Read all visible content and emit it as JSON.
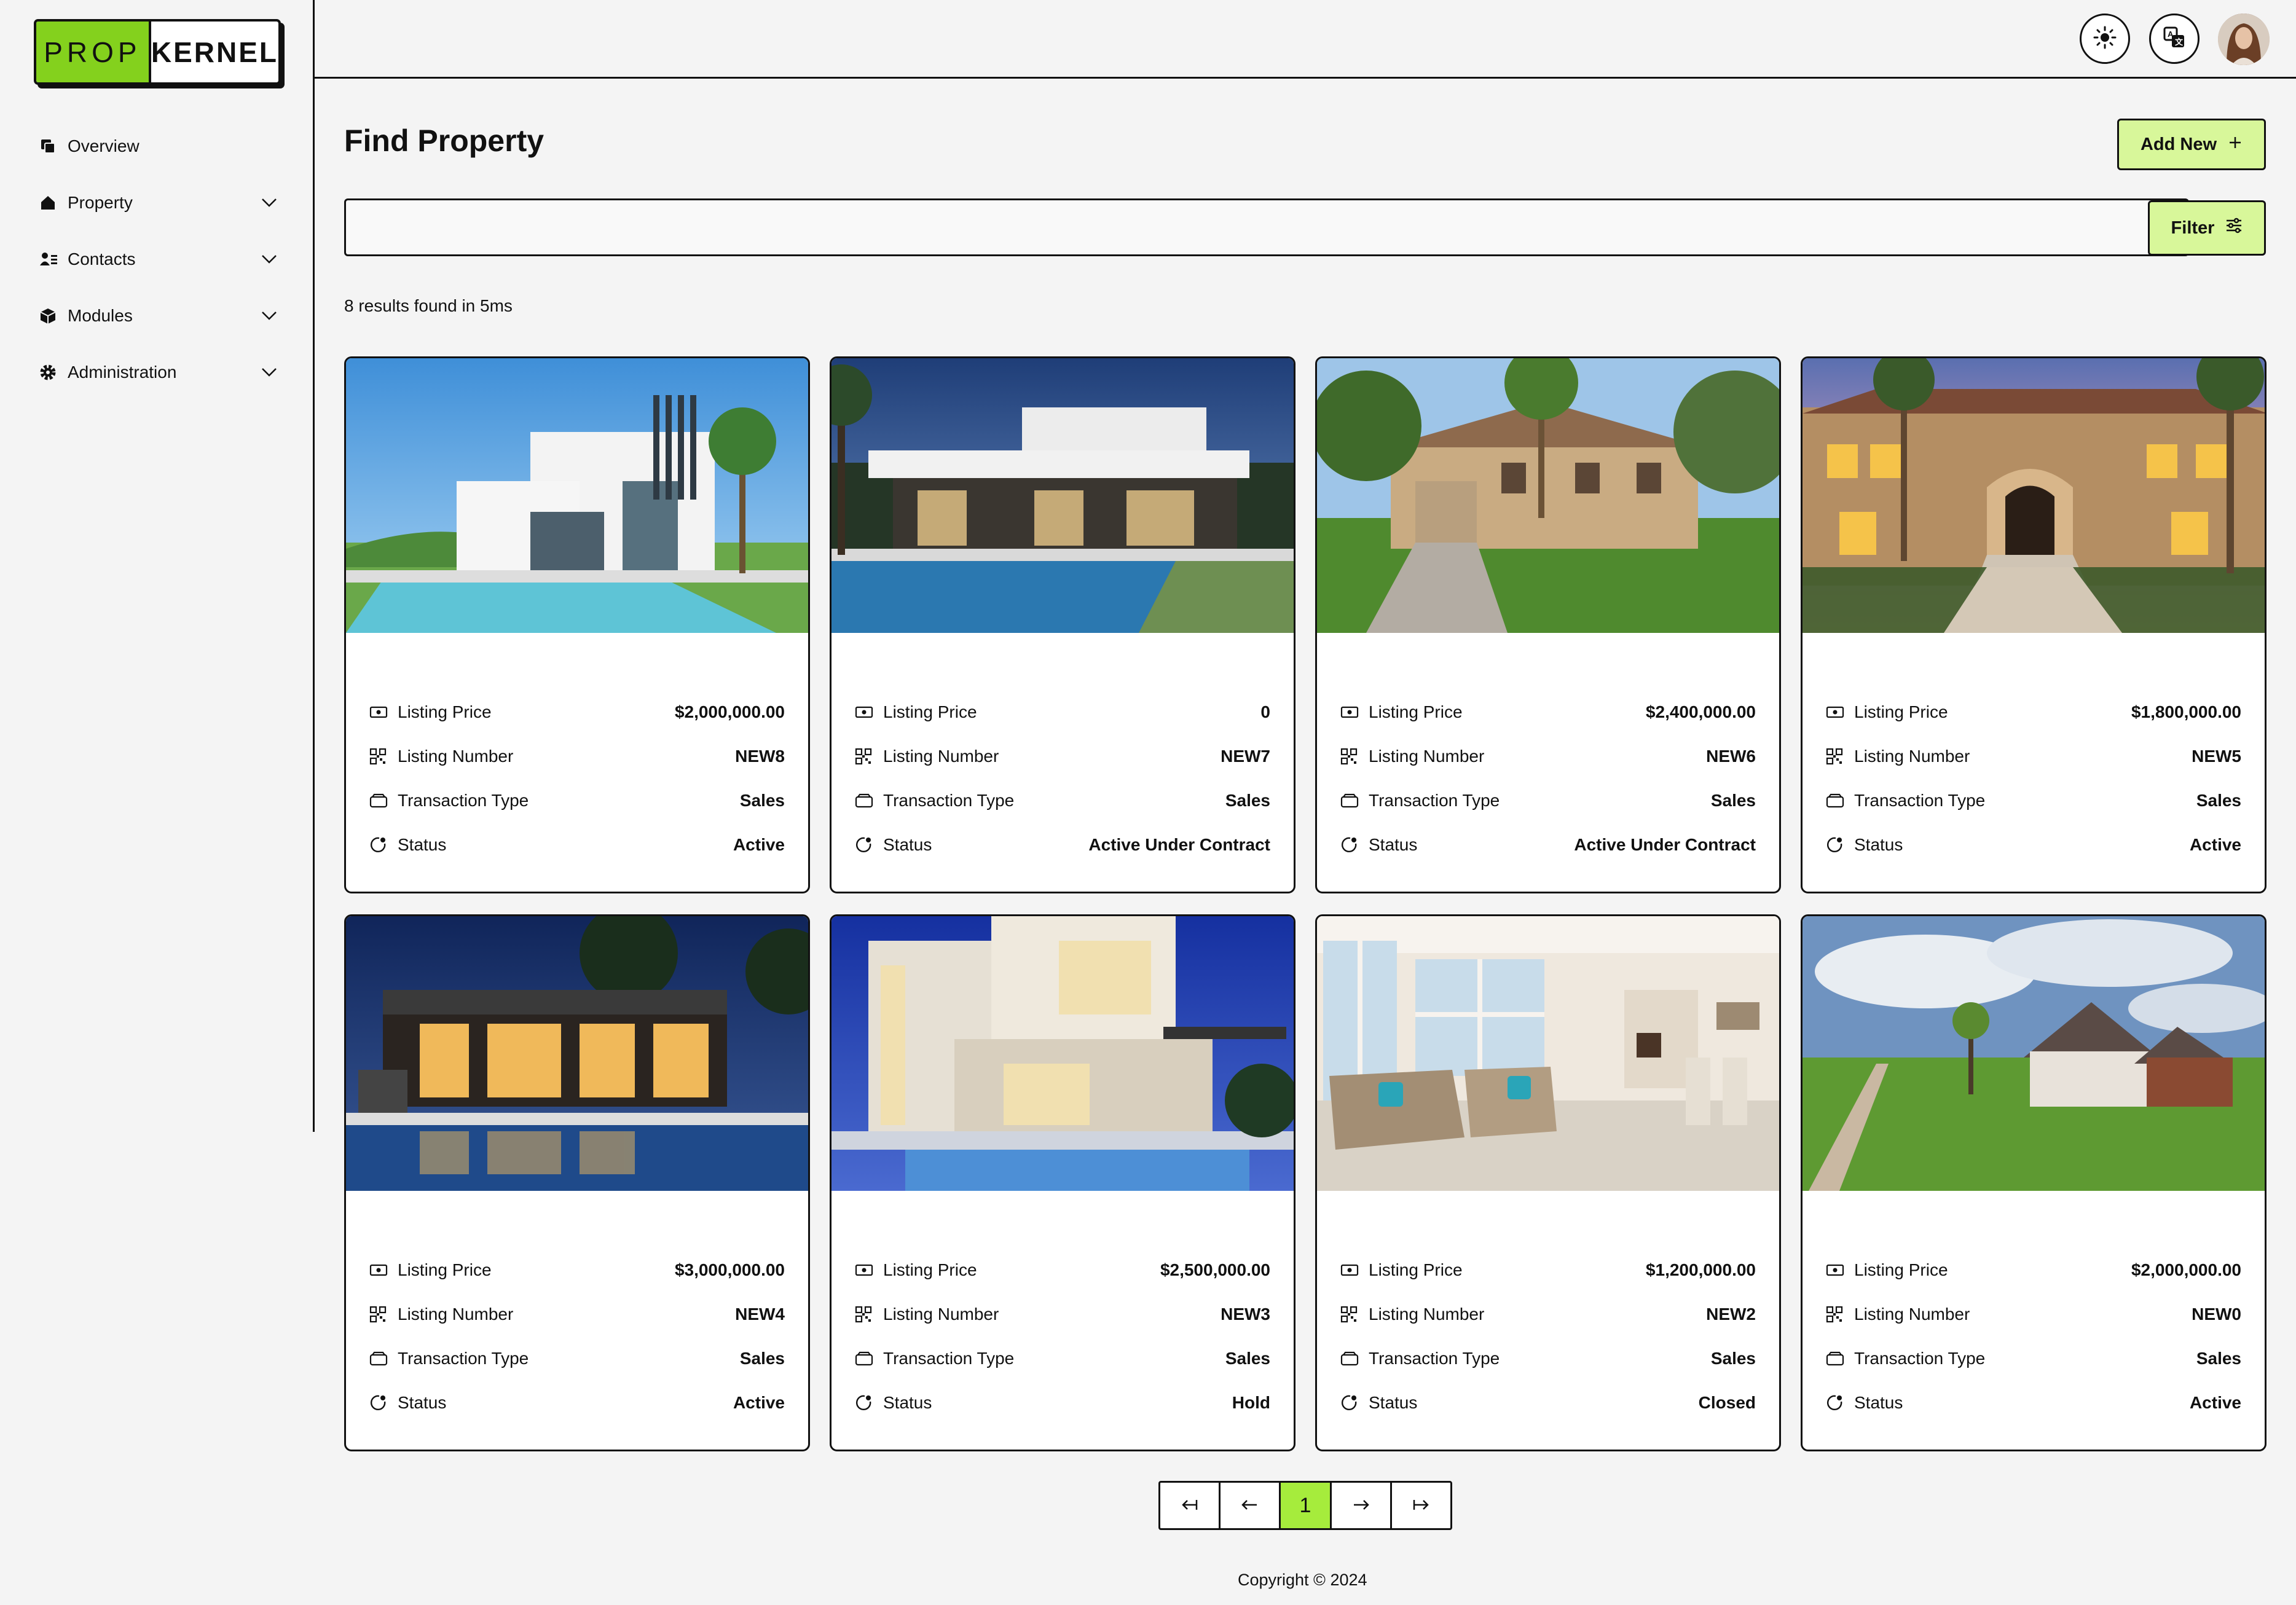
{
  "brand": {
    "part1": "PROP",
    "part2": "KERNEL"
  },
  "sidebar": {
    "items": [
      {
        "label": "Overview",
        "icon": "overview-icon",
        "expandable": false
      },
      {
        "label": "Property",
        "icon": "home-icon",
        "expandable": true
      },
      {
        "label": "Contacts",
        "icon": "contacts-icon",
        "expandable": true
      },
      {
        "label": "Modules",
        "icon": "cube-icon",
        "expandable": true
      },
      {
        "label": "Administration",
        "icon": "gear-icon",
        "expandable": true
      }
    ]
  },
  "topbar": {
    "theme_icon": "sun-icon",
    "language_icon": "translate-icon",
    "avatar": "user-avatar"
  },
  "main": {
    "title": "Find Property",
    "add_new_label": "Add New",
    "filter_label": "Filter",
    "search_value": "",
    "results_text": "8 results found in 5ms"
  },
  "field_labels": {
    "price": "Listing Price",
    "number": "Listing Number",
    "transaction": "Transaction Type",
    "status": "Status"
  },
  "listings": [
    {
      "price": "$2,000,000.00",
      "number": "NEW8",
      "transaction": "Sales",
      "status": "Active"
    },
    {
      "price": "0",
      "number": "NEW7",
      "transaction": "Sales",
      "status": "Active Under Contract"
    },
    {
      "price": "$2,400,000.00",
      "number": "NEW6",
      "transaction": "Sales",
      "status": "Active Under Contract"
    },
    {
      "price": "$1,800,000.00",
      "number": "NEW5",
      "transaction": "Sales",
      "status": "Active"
    },
    {
      "price": "$3,000,000.00",
      "number": "NEW4",
      "transaction": "Sales",
      "status": "Active"
    },
    {
      "price": "$2,500,000.00",
      "number": "NEW3",
      "transaction": "Sales",
      "status": "Hold"
    },
    {
      "price": "$1,200,000.00",
      "number": "NEW2",
      "transaction": "Sales",
      "status": "Closed"
    },
    {
      "price": "$2,000,000.00",
      "number": "NEW0",
      "transaction": "Sales",
      "status": "Active"
    }
  ],
  "pagination": {
    "current_page": "1"
  },
  "footer": {
    "copyright": "Copyright © 2024"
  },
  "colors": {
    "accent": "#84d11d",
    "button_bg": "#d8f79a",
    "active_page": "#a6ec3c"
  }
}
